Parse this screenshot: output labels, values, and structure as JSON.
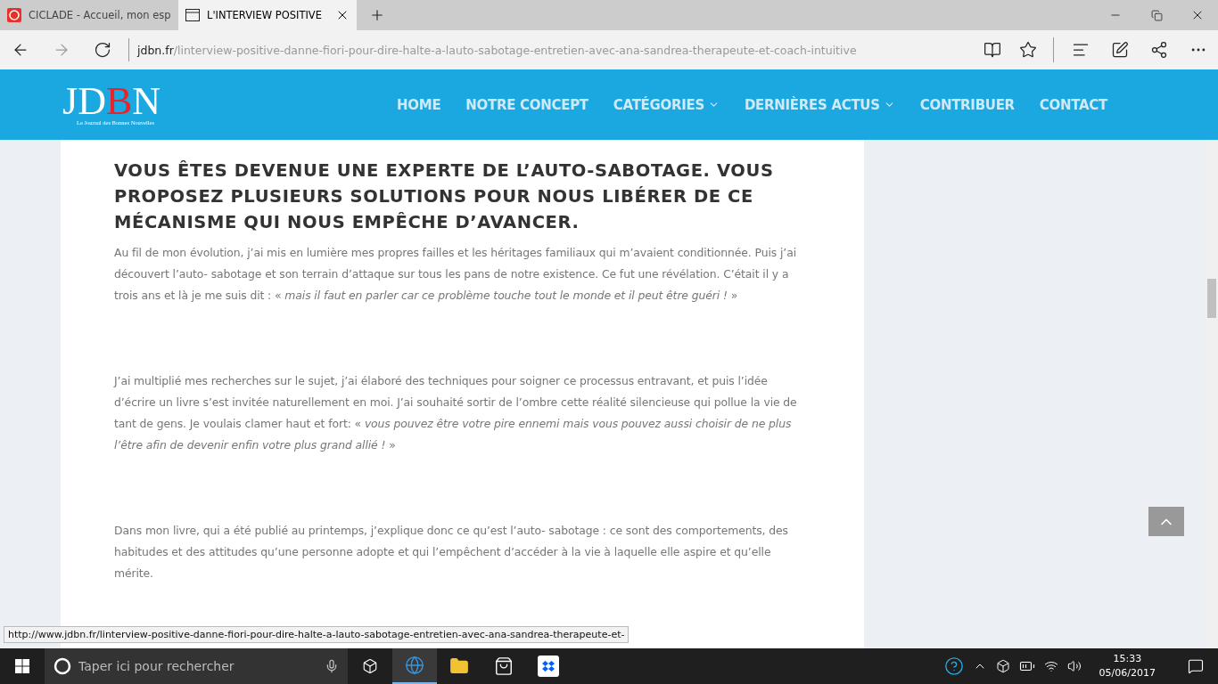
{
  "browser": {
    "tabs": [
      {
        "label": "CICLADE - Accueil, mon esp",
        "selected": false
      },
      {
        "label": "L'INTERVIEW POSITIVE",
        "selected": true
      }
    ],
    "address": {
      "domain": "jdbn.fr",
      "path": "/linterview-positive-danne-fiori-pour-dire-halte-a-lauto-sabotage-entretien-avec-ana-sandrea-therapeute-et-coach-intuitive"
    }
  },
  "site": {
    "logo": {
      "letters": [
        "J",
        "D",
        "B",
        "N"
      ],
      "tagline": "Le Journal des Bonnes Nouvelles"
    },
    "nav": [
      {
        "label": "HOME",
        "dropdown": false
      },
      {
        "label": "NOTRE CONCEPT",
        "dropdown": false
      },
      {
        "label": "CATÉGORIES",
        "dropdown": true
      },
      {
        "label": "DERNIÈRES ACTUS",
        "dropdown": true
      },
      {
        "label": "CONTRIBUER",
        "dropdown": false
      },
      {
        "label": "CONTACT",
        "dropdown": false
      }
    ]
  },
  "article": {
    "heading": "VOUS ÊTES DEVENUE UNE EXPERTE DE L’AUTO-SABOTAGE. VOUS PROPOSEZ PLUSIEURS SOLUTIONS POUR NOUS LIBÉRER DE CE MÉCANISME QUI NOUS EMPÊCHE D’AVANCER.",
    "paragraphs": [
      "Au fil de mon évolution, j’ai mis en lumière mes propres failles et les héritages familiaux qui m’avaient conditionnée. Puis j’ai découvert l’auto- sabotage et son terrain d’attaque sur tous les pans de notre existence. Ce fut une révélation. C’était il y a trois ans et là je me suis dit : « *mais il faut en parler car ce problème touche tout le monde et il peut être guéri !* »",
      "J’ai multiplié mes recherches sur le sujet, j’ai élaboré des techniques pour soigner ce processus entravant, et puis l’idée d’écrire un livre s’est invitée naturellement en moi. J’ai souhaité sortir de l’ombre cette réalité silencieuse qui pollue la vie de tant de gens. Je voulais clamer haut et fort: « *vous pouvez être votre pire ennemi mais vous pouvez aussi choisir de ne plus l’être afin de devenir enfin votre plus grand allié !* »",
      "Dans mon livre, qui a été publié au printemps, j’explique donc ce qu’est l’auto- sabotage : ce sont des comportements, des habitudes et des attitudes qu’une personne adopte et qui l’empêchent d’accéder à la vie à laquelle elle aspire et qu’elle mérite."
    ]
  },
  "status_url": "http://www.jdbn.fr/linterview-positive-danne-fiori-pour-dire-halte-a-lauto-sabotage-entretien-avec-ana-sandrea-therapeute-et-",
  "taskbar": {
    "search_placeholder": "Taper ici pour rechercher",
    "time": "15:33",
    "date": "05/06/2017"
  }
}
